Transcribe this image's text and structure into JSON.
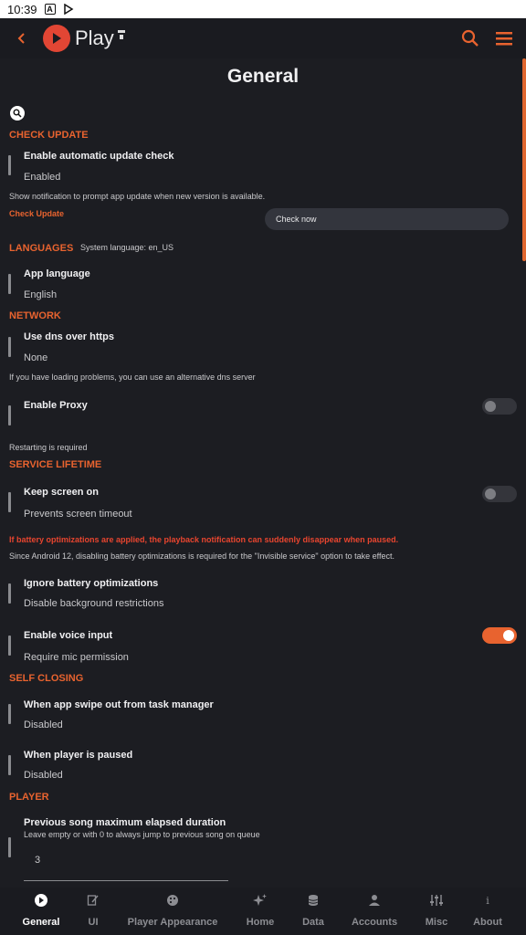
{
  "status_bar": {
    "time": "10:39"
  },
  "app": {
    "name": "Play",
    "accent": "#e8632f"
  },
  "page": {
    "title": "General"
  },
  "sections": {
    "check_update": "CHECK UPDATE",
    "languages": "LANGUAGES",
    "network": "NETWORK",
    "service_lifetime": "SERVICE LIFETIME",
    "self_closing": "SELF CLOSING",
    "player": "PLAYER"
  },
  "check_update": {
    "title": "Enable automatic update check",
    "value": "Enabled",
    "note": "Show notification to prompt app update when new version is available.",
    "link": "Check Update",
    "button": "Check now"
  },
  "languages": {
    "system": "System language: en_US",
    "title": "App language",
    "value": "English"
  },
  "network": {
    "dns_title": "Use dns over https",
    "dns_value": "None",
    "dns_note": "If you have loading problems, you can use an alternative dns server",
    "proxy_title": "Enable Proxy",
    "proxy_on": false,
    "proxy_note": "Restarting is required"
  },
  "service": {
    "keep_title": "Keep screen on",
    "keep_sub": "Prevents screen timeout",
    "keep_on": false,
    "warn": "If battery optimizations are applied, the playback notification can suddenly disappear when paused.",
    "note": "Since Android 12, disabling battery optimizations is required for the \"Invisible service\" option to take effect.",
    "battery_title": "Ignore battery optimizations",
    "battery_sub": "Disable background restrictions",
    "voice_title": "Enable voice input",
    "voice_sub": "Require mic permission",
    "voice_on": true
  },
  "self_closing": {
    "swipe_title": "When app swipe out from task manager",
    "swipe_value": "Disabled",
    "paused_title": "When player is paused",
    "paused_value": "Disabled"
  },
  "player": {
    "prev_title": "Previous song maximum elapsed duration",
    "prev_hint": "Leave empty or with 0 to always jump to previous song on queue",
    "prev_value": "3"
  },
  "nav": [
    {
      "label": "General",
      "icon": "play-logo-icon",
      "active": true
    },
    {
      "label": "UI",
      "icon": "brush-icon",
      "active": false
    },
    {
      "label": "Player Appearance",
      "icon": "palette-icon",
      "active": false
    },
    {
      "label": "Home",
      "icon": "sparkle-icon",
      "active": false
    },
    {
      "label": "Data",
      "icon": "database-icon",
      "active": false
    },
    {
      "label": "Accounts",
      "icon": "person-icon",
      "active": false
    },
    {
      "label": "Misc",
      "icon": "sliders-icon",
      "active": false
    },
    {
      "label": "About",
      "icon": "info-icon",
      "active": false
    }
  ]
}
